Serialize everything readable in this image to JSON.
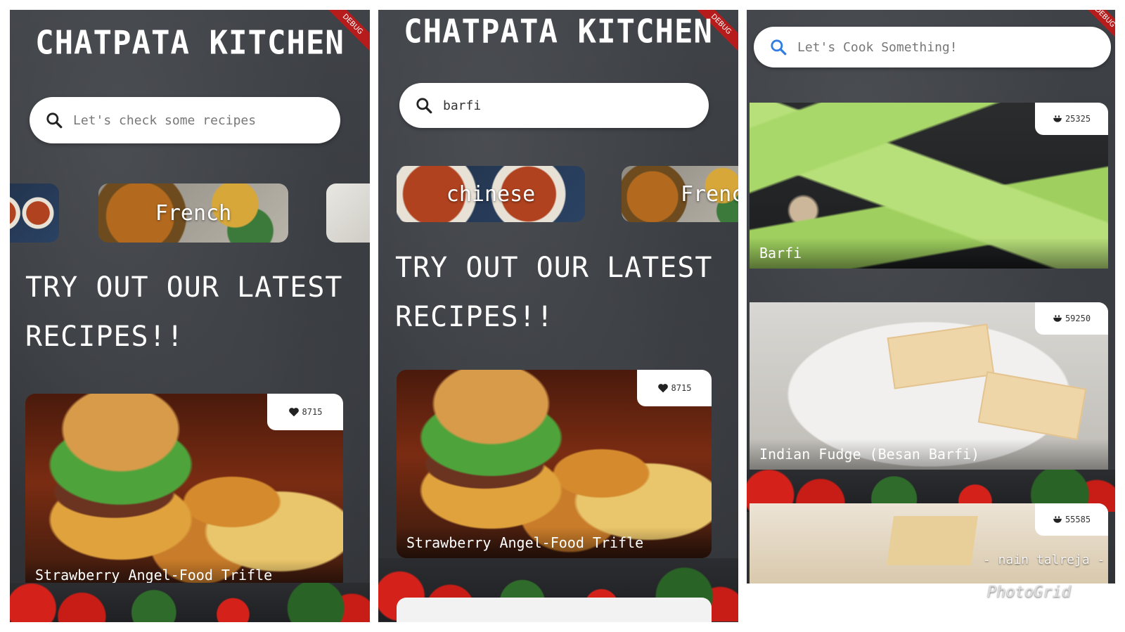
{
  "app": {
    "title": "CHATPATA KITCHEN",
    "debug_label": "DEBUG",
    "section_heading_line1": "TRY OUT OUR LATEST",
    "section_heading_line2": "RECIPES!!"
  },
  "screens": [
    {
      "search_placeholder": "Let's check some recipes",
      "search_value": "",
      "cuisines": [
        "French"
      ],
      "featured_recipe": {
        "name": "Strawberry Angel-Food Trifle",
        "likes": "8715"
      }
    },
    {
      "search_placeholder": "",
      "search_value": "barfi",
      "cuisines": [
        "chinese",
        "French"
      ],
      "featured_recipe": {
        "name": "Strawberry Angel-Food Trifle",
        "likes": "8715"
      }
    },
    {
      "search_placeholder": "Let's Cook Something!",
      "search_value": "",
      "results": [
        {
          "name": "Barfi",
          "count": "25325"
        },
        {
          "name": "Indian Fudge (Besan Barfi)",
          "count": "59250"
        },
        {
          "name": "",
          "count": "55585"
        }
      ]
    }
  ],
  "watermarks": {
    "author": "- nain talreja -",
    "brand": "PhotoGrid"
  },
  "colors": {
    "background": "#3a3d41",
    "search_icon_dark": "#222222",
    "search_icon_blue": "#2f7de1",
    "debug_ribbon": "#b71c1c"
  },
  "icons": {
    "search": "search-icon",
    "heart": "heart-icon",
    "bowl": "bowl-icon"
  }
}
